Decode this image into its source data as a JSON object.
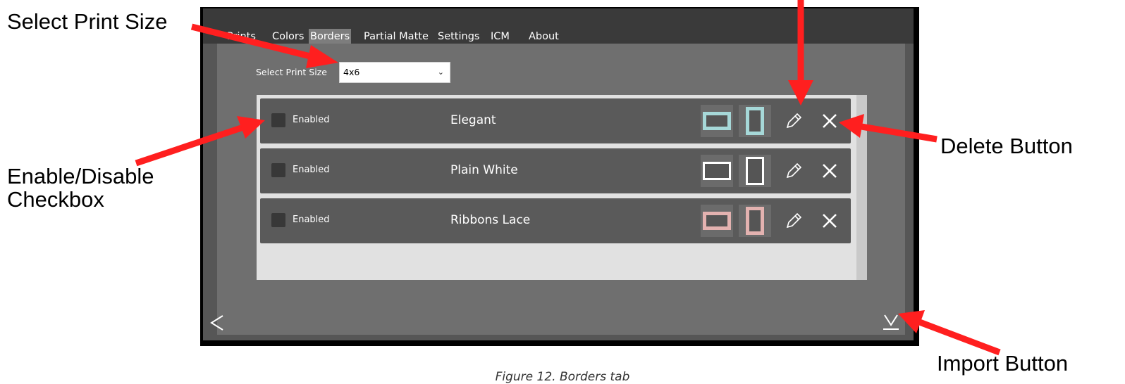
{
  "annotations": {
    "select_print_size": "Select Print Size",
    "enable_disable_line1": "Enable/Disable",
    "enable_disable_line2": "Checkbox",
    "delete_button": "Delete Button",
    "import_button": "Import Button"
  },
  "caption": "Figure 12. Borders tab",
  "tabs": [
    {
      "label": "Prints",
      "active": false
    },
    {
      "label": "Colors",
      "active": false
    },
    {
      "label": "Borders",
      "active": true
    },
    {
      "label": "Partial Matte",
      "active": false
    },
    {
      "label": "Settings",
      "active": false
    },
    {
      "label": "ICM",
      "active": false
    },
    {
      "label": "About",
      "active": false
    }
  ],
  "print_size": {
    "label": "Select Print Size",
    "value": "4x6"
  },
  "borders": [
    {
      "enabled_label": "Enabled",
      "checked": false,
      "name": "Elegant",
      "thumb_color": "#a6d8d8"
    },
    {
      "enabled_label": "Enabled",
      "checked": false,
      "name": "Plain White",
      "thumb_color": "#ffffff"
    },
    {
      "enabled_label": "Enabled",
      "checked": false,
      "name": "Ribbons Lace",
      "thumb_color": "#e3b2b0"
    }
  ],
  "icons": {
    "edit": "pencil-icon",
    "delete": "close-icon",
    "back": "chevron-left-icon",
    "import": "download-icon"
  },
  "colors": {
    "arrow": "#ff1f1f",
    "header": "#3a3a3a",
    "panel": "#6f6f6f",
    "list": "#e1e1e1",
    "row": "#5a5a5a"
  }
}
